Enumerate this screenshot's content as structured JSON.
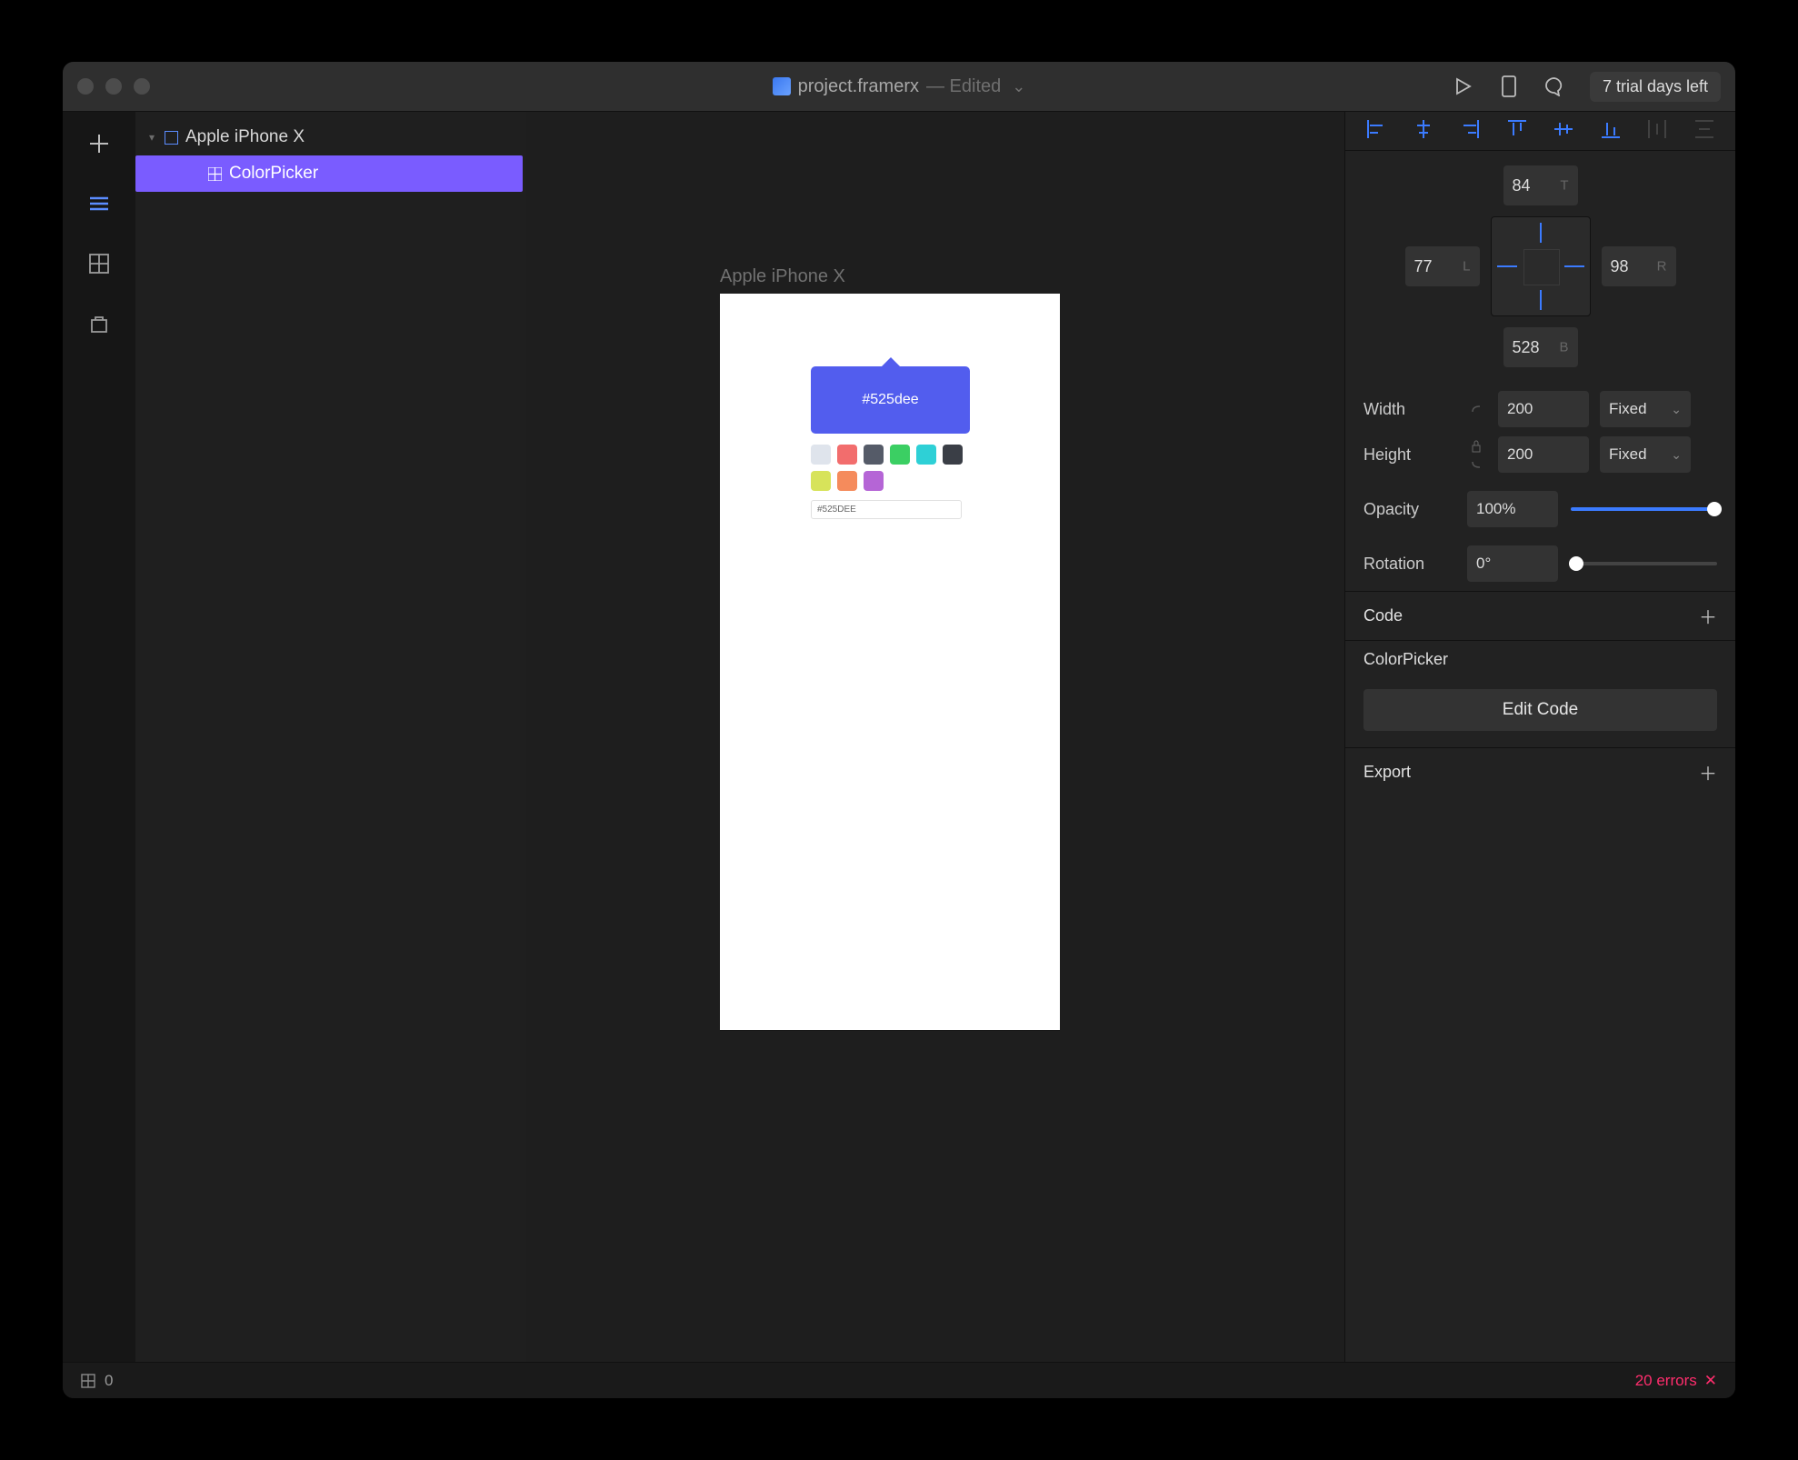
{
  "titlebar": {
    "filename": "project.framerx",
    "edited_label": "— Edited",
    "trial_label": "7 trial days left"
  },
  "tools": {
    "items": [
      "insert",
      "layers",
      "components",
      "store"
    ]
  },
  "layers": {
    "root": {
      "label": "Apple iPhone X"
    },
    "children": [
      {
        "label": "ColorPicker",
        "selected": true
      }
    ]
  },
  "canvas": {
    "device_label": "Apple iPhone X",
    "colorpicker": {
      "display_hex": "#525dee",
      "input_value": "#525DEE",
      "swatches": [
        "#dfe4ec",
        "#f26d6d",
        "#555b68",
        "#3bcf63",
        "#2ed0d6",
        "#3a3e46",
        "#d7e35a",
        "#f58b5c",
        "#b565d6"
      ]
    }
  },
  "inspector": {
    "constraints": {
      "top": "84",
      "top_u": "T",
      "left": "77",
      "left_u": "L",
      "right": "98",
      "right_u": "R",
      "bottom": "528",
      "bottom_u": "B"
    },
    "width": {
      "label": "Width",
      "value": "200",
      "mode": "Fixed"
    },
    "height": {
      "label": "Height",
      "value": "200",
      "mode": "Fixed"
    },
    "opacity": {
      "label": "Opacity",
      "value": "100%"
    },
    "rotation": {
      "label": "Rotation",
      "value": "0°"
    },
    "code_section": {
      "title": "Code",
      "component_name": "ColorPicker",
      "edit_label": "Edit Code"
    },
    "export_section": {
      "title": "Export"
    }
  },
  "statusbar": {
    "zoom_value": "0",
    "errors_label": "20 errors"
  }
}
